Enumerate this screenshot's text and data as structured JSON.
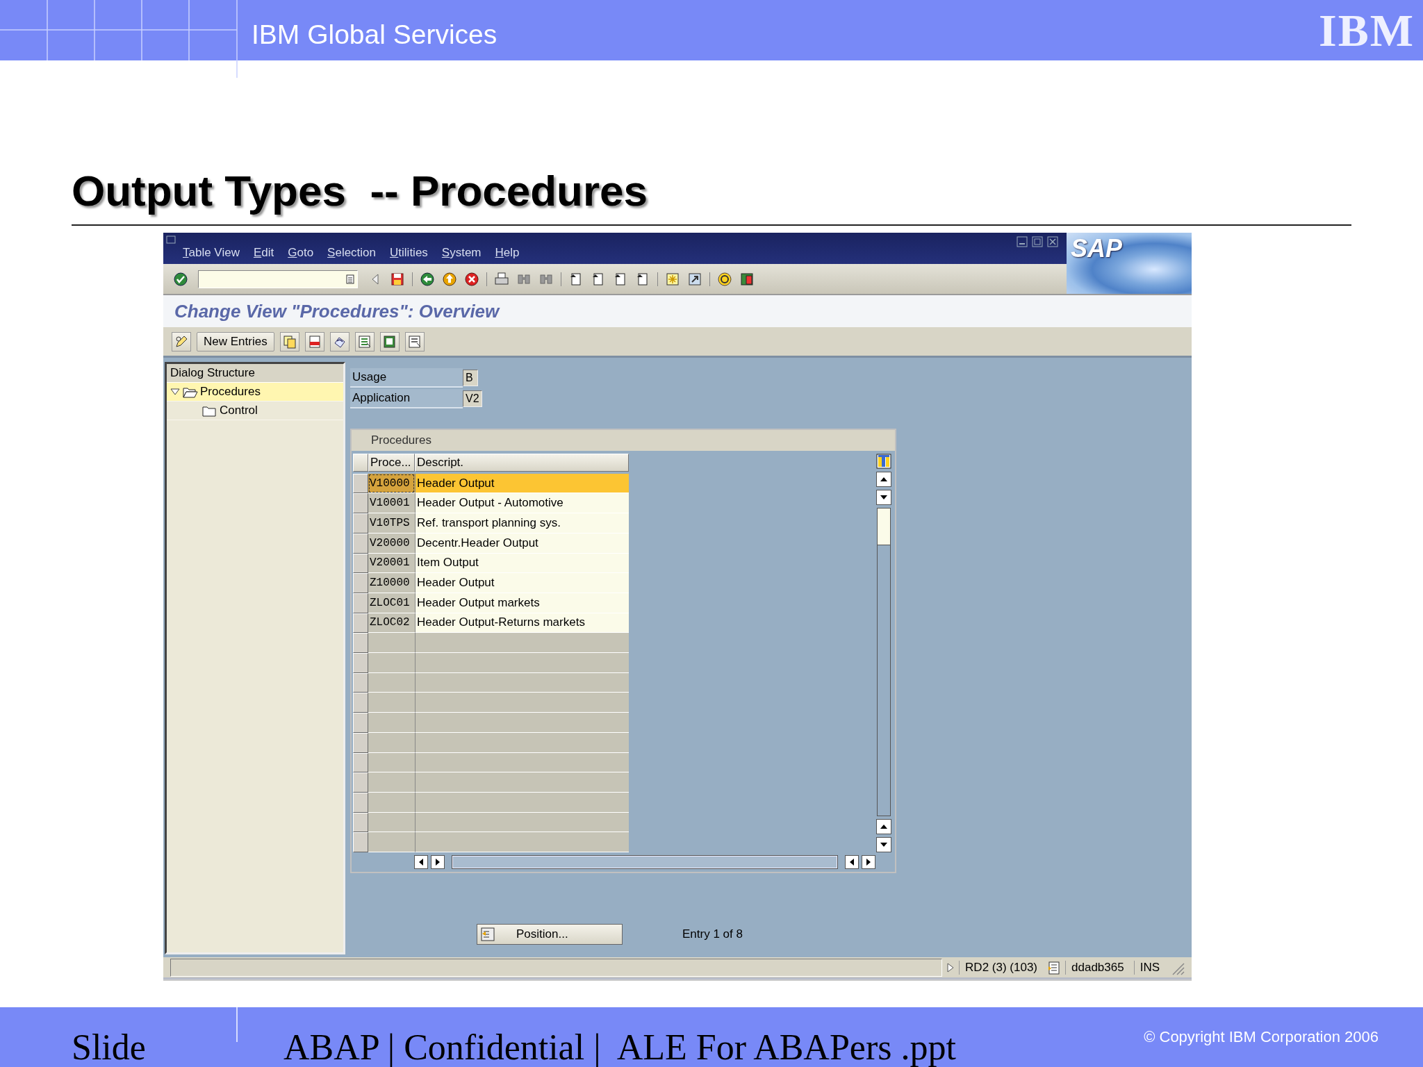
{
  "header": {
    "title": "IBM Global Services",
    "logo": "IBM"
  },
  "slide_title": "Output Types  -- Procedures",
  "sap": {
    "menu": [
      "Table View",
      "Edit",
      "Goto",
      "Selection",
      "Utilities",
      "System",
      "Help"
    ],
    "logo": "SAP",
    "screen_title": "Change View \"Procedures\": Overview",
    "new_entries": "New Entries",
    "dialog_structure": {
      "title": "Dialog Structure",
      "items": [
        {
          "label": "Procedures",
          "selected": true,
          "expanded": true,
          "children": [
            {
              "label": "Control",
              "selected": false
            }
          ]
        }
      ]
    },
    "fields": [
      {
        "label": "Usage",
        "value": "B"
      },
      {
        "label": "Application",
        "value": "V2"
      }
    ],
    "table": {
      "title": "Procedures",
      "columns": [
        "Proce...",
        "Descript."
      ],
      "rows": [
        {
          "cells": [
            "V10000",
            "Header Output"
          ],
          "selected": true
        },
        {
          "cells": [
            "V10001",
            "Header Output - Automotive"
          ],
          "selected": false
        },
        {
          "cells": [
            "V10TPS",
            "Ref. transport planning sys."
          ],
          "selected": false
        },
        {
          "cells": [
            "V20000",
            "Decentr.Header Output"
          ],
          "selected": false
        },
        {
          "cells": [
            "V20001",
            "Item Output"
          ],
          "selected": false
        },
        {
          "cells": [
            "Z10000",
            "Header Output"
          ],
          "selected": false
        },
        {
          "cells": [
            "ZLOC01",
            "Header Output markets"
          ],
          "selected": false
        },
        {
          "cells": [
            "ZLOC02",
            "Header Output-Returns markets"
          ],
          "selected": false
        }
      ]
    },
    "position_button": "Position...",
    "entry_info": "Entry 1 of 8",
    "status_bar": {
      "system": "RD2 (3) (103)",
      "server": "ddadb365",
      "mode": "INS"
    }
  },
  "footer": {
    "slide": "Slide",
    "file": "ABAP | Confidential |  ALE For ABAPers .ppt",
    "copyright": "© Copyright IBM Corporation 2006"
  }
}
